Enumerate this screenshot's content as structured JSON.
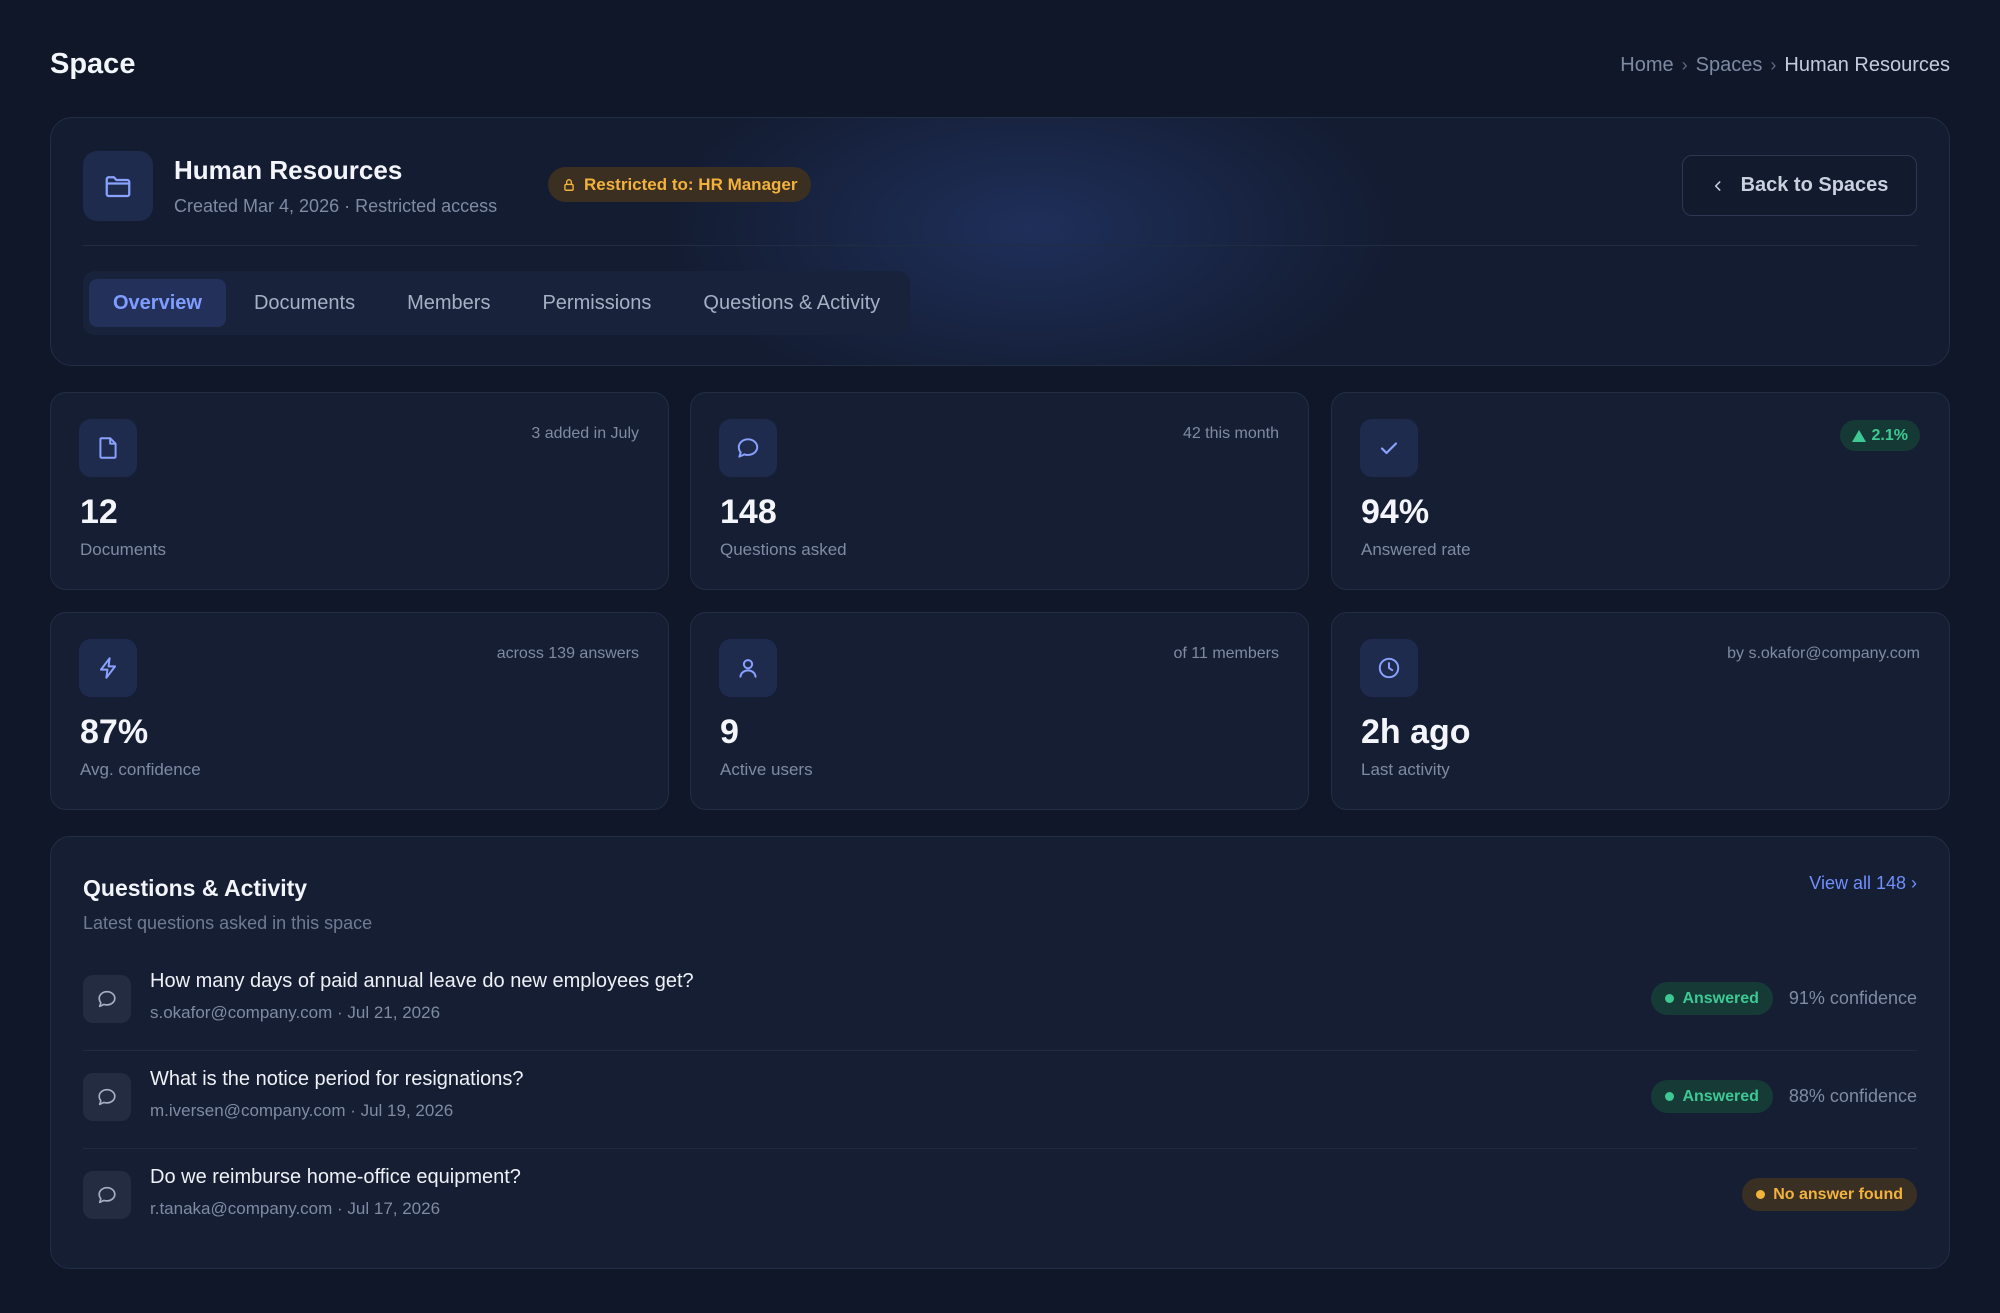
{
  "page": {
    "title": "Space"
  },
  "breadcrumb": [
    "Home",
    "Spaces",
    "Human Resources"
  ],
  "header": {
    "name": "Human Resources",
    "subtitle": "Created Mar 4, 2026 · Restricted access",
    "restriction": "Restricted to: HR Manager",
    "back_label": "Back to Spaces",
    "icon": "folder-icon"
  },
  "tabs": [
    {
      "label": "Overview",
      "active": true
    },
    {
      "label": "Documents",
      "active": false
    },
    {
      "label": "Members",
      "active": false
    },
    {
      "label": "Permissions",
      "active": false
    },
    {
      "label": "Questions & Activity",
      "active": false
    }
  ],
  "stats": [
    {
      "icon": "document-icon",
      "value": "12",
      "label": "Documents",
      "note": "3 added in July"
    },
    {
      "icon": "chat-icon",
      "value": "148",
      "label": "Questions asked",
      "note": "42 this month"
    },
    {
      "icon": "check-icon",
      "value": "94%",
      "label": "Answered rate",
      "trend": "2.1%"
    },
    {
      "icon": "bolt-icon",
      "value": "87%",
      "label": "Avg. confidence",
      "note": "across 139 answers"
    },
    {
      "icon": "user-icon",
      "value": "9",
      "label": "Active users",
      "note": "of 11 members"
    },
    {
      "icon": "clock-icon",
      "value": "2h ago",
      "label": "Last activity",
      "note": "by s.okafor@company.com"
    }
  ],
  "activity": {
    "title": "Questions & Activity",
    "subtitle": "Latest questions asked in this space",
    "view_all": "View all 148 ›",
    "items": [
      {
        "question": "How many days of paid annual leave do new employees get?",
        "meta": "s.okafor@company.com · Jul 21, 2026",
        "status": "Answered",
        "confidence": "91% confidence"
      },
      {
        "question": "What is the notice period for resignations?",
        "meta": "m.iversen@company.com · Jul 19, 2026",
        "status": "Answered",
        "confidence": "88% confidence"
      },
      {
        "question": "Do we reimburse home-office equipment?",
        "meta": "r.tanaka@company.com · Jul 17, 2026",
        "status": "No answer found",
        "confidence": ""
      }
    ]
  },
  "colors": {
    "accent": "#7f9cff",
    "success": "#3ec994",
    "warning": "#f2b23c",
    "background": "#0f1729",
    "card": "#151e33"
  }
}
